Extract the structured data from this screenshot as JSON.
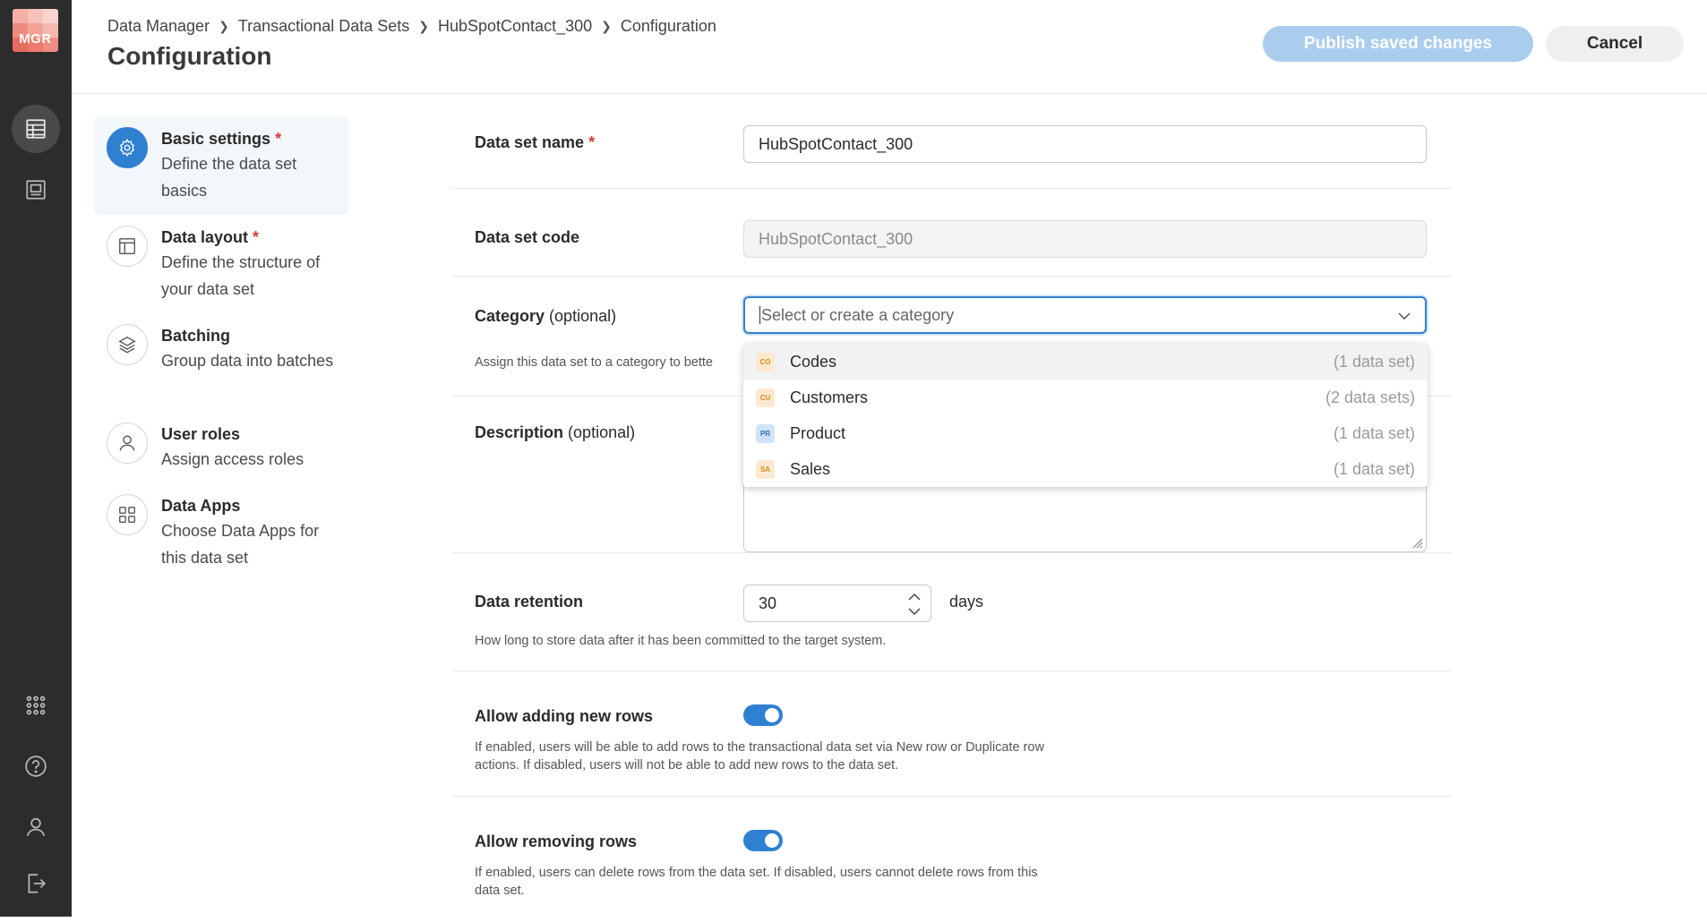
{
  "rail": {
    "logo_text": "MGR",
    "items": [
      "data-sets-icon",
      "reports-icon"
    ],
    "bottom": [
      "apps-grid-icon",
      "help-icon",
      "user-icon",
      "logout-icon"
    ]
  },
  "header": {
    "breadcrumb": [
      "Data Manager",
      "Transactional Data Sets",
      "HubSpotContact_300",
      "Configuration"
    ],
    "title": "Configuration",
    "publish_label": "Publish saved changes",
    "cancel_label": "Cancel"
  },
  "steps": [
    {
      "title": "Basic settings",
      "required": "*",
      "desc": "Define the data set basics",
      "icon": "gear-icon"
    },
    {
      "title": "Data layout",
      "required": "*",
      "desc": "Define the structure of your data set",
      "icon": "layout-icon"
    },
    {
      "title": "Batching",
      "required": "",
      "desc": "Group data into batches",
      "icon": "layers-icon"
    },
    {
      "title": "User roles",
      "required": "",
      "desc": "Assign access roles",
      "icon": "user-icon"
    },
    {
      "title": "Data Apps",
      "required": "",
      "desc": "Choose Data Apps for this data set",
      "icon": "apps-icon"
    }
  ],
  "form": {
    "name_label": "Data set name",
    "name_required": "*",
    "name_value": "HubSpotContact_300",
    "code_label": "Data set code",
    "code_value": "HubSpotContact_300",
    "category_label": "Category",
    "category_optional": "(optional)",
    "category_placeholder": "Select or create a category",
    "category_hint": "Assign this data set to a category to bette",
    "description_label": "Description",
    "description_optional": "(optional)",
    "retention_label": "Data retention",
    "retention_value": "30",
    "retention_unit": "days",
    "retention_hint": "How long to store data after it has been committed to the target system.",
    "add_rows_label": "Allow adding new rows",
    "add_rows_enabled": true,
    "add_rows_hint_1": "If enabled, users will be able to add rows to the transactional data set via New row or Duplicate row",
    "add_rows_hint_2": "actions. If disabled, users will not be able to add new rows to the data set.",
    "remove_rows_label": "Allow removing rows",
    "remove_rows_enabled": true,
    "remove_rows_hint_1": "If enabled, users can delete rows from the data set. If disabled, users cannot delete rows from this",
    "remove_rows_hint_2": "data set."
  },
  "dropdown": {
    "options": [
      {
        "badge": "CO",
        "label": "Codes",
        "count": "(1 data set)",
        "badge_bg": "#fde9cf",
        "badge_fg": "#d88a1c"
      },
      {
        "badge": "CU",
        "label": "Customers",
        "count": "(2 data sets)",
        "badge_bg": "#fde9cf",
        "badge_fg": "#d88a1c"
      },
      {
        "badge": "PR",
        "label": "Product",
        "count": "(1 data set)",
        "badge_bg": "#cfe3f8",
        "badge_fg": "#2f6fb8"
      },
      {
        "badge": "SA",
        "label": "Sales",
        "count": "(1 data set)",
        "badge_bg": "#fde9cf",
        "badge_fg": "#d88a1c"
      }
    ]
  },
  "colors": {
    "accent": "#2f80d1",
    "publish_disabled": "#aacdee",
    "rail_bg": "#2c2c2c",
    "required": "#d23c3c"
  }
}
